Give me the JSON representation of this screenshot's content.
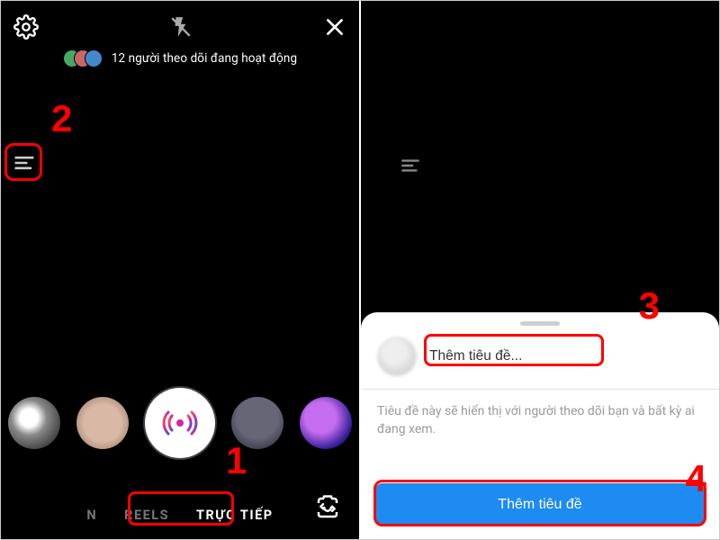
{
  "left": {
    "activity_text": "12 người theo dõi đang hoạt động",
    "modes": {
      "reels": "REELS",
      "live": "TRỰC TIẾP",
      "faded_prefix": "N"
    },
    "avatar_colors": [
      "#4a6",
      "#c66",
      "#48c"
    ]
  },
  "right": {
    "sheet": {
      "placeholder": "Thêm tiêu đề...",
      "hint": "Tiêu đề này sẽ hiển thị với người theo dõi bạn và bất kỳ ai đang xem.",
      "button": "Thêm tiêu đề"
    }
  },
  "annotations": {
    "n1": "1",
    "n2": "2",
    "n3": "3",
    "n4": "4"
  }
}
